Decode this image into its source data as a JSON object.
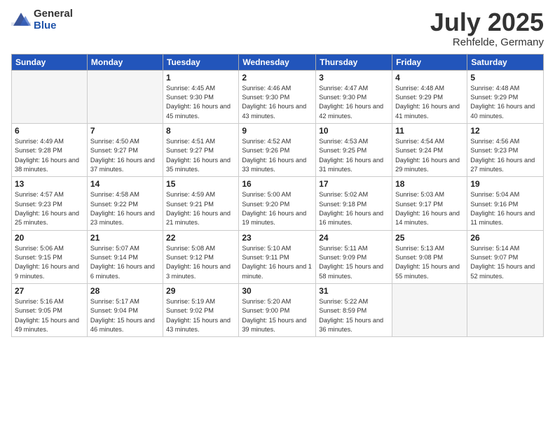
{
  "logo": {
    "general": "General",
    "blue": "Blue"
  },
  "header": {
    "month": "July 2025",
    "location": "Rehfelde, Germany"
  },
  "weekdays": [
    "Sunday",
    "Monday",
    "Tuesday",
    "Wednesday",
    "Thursday",
    "Friday",
    "Saturday"
  ],
  "weeks": [
    [
      {
        "day": "",
        "info": ""
      },
      {
        "day": "",
        "info": ""
      },
      {
        "day": "1",
        "info": "Sunrise: 4:45 AM\nSunset: 9:30 PM\nDaylight: 16 hours\nand 45 minutes."
      },
      {
        "day": "2",
        "info": "Sunrise: 4:46 AM\nSunset: 9:30 PM\nDaylight: 16 hours\nand 43 minutes."
      },
      {
        "day": "3",
        "info": "Sunrise: 4:47 AM\nSunset: 9:30 PM\nDaylight: 16 hours\nand 42 minutes."
      },
      {
        "day": "4",
        "info": "Sunrise: 4:48 AM\nSunset: 9:29 PM\nDaylight: 16 hours\nand 41 minutes."
      },
      {
        "day": "5",
        "info": "Sunrise: 4:48 AM\nSunset: 9:29 PM\nDaylight: 16 hours\nand 40 minutes."
      }
    ],
    [
      {
        "day": "6",
        "info": "Sunrise: 4:49 AM\nSunset: 9:28 PM\nDaylight: 16 hours\nand 38 minutes."
      },
      {
        "day": "7",
        "info": "Sunrise: 4:50 AM\nSunset: 9:27 PM\nDaylight: 16 hours\nand 37 minutes."
      },
      {
        "day": "8",
        "info": "Sunrise: 4:51 AM\nSunset: 9:27 PM\nDaylight: 16 hours\nand 35 minutes."
      },
      {
        "day": "9",
        "info": "Sunrise: 4:52 AM\nSunset: 9:26 PM\nDaylight: 16 hours\nand 33 minutes."
      },
      {
        "day": "10",
        "info": "Sunrise: 4:53 AM\nSunset: 9:25 PM\nDaylight: 16 hours\nand 31 minutes."
      },
      {
        "day": "11",
        "info": "Sunrise: 4:54 AM\nSunset: 9:24 PM\nDaylight: 16 hours\nand 29 minutes."
      },
      {
        "day": "12",
        "info": "Sunrise: 4:56 AM\nSunset: 9:23 PM\nDaylight: 16 hours\nand 27 minutes."
      }
    ],
    [
      {
        "day": "13",
        "info": "Sunrise: 4:57 AM\nSunset: 9:23 PM\nDaylight: 16 hours\nand 25 minutes."
      },
      {
        "day": "14",
        "info": "Sunrise: 4:58 AM\nSunset: 9:22 PM\nDaylight: 16 hours\nand 23 minutes."
      },
      {
        "day": "15",
        "info": "Sunrise: 4:59 AM\nSunset: 9:21 PM\nDaylight: 16 hours\nand 21 minutes."
      },
      {
        "day": "16",
        "info": "Sunrise: 5:00 AM\nSunset: 9:20 PM\nDaylight: 16 hours\nand 19 minutes."
      },
      {
        "day": "17",
        "info": "Sunrise: 5:02 AM\nSunset: 9:18 PM\nDaylight: 16 hours\nand 16 minutes."
      },
      {
        "day": "18",
        "info": "Sunrise: 5:03 AM\nSunset: 9:17 PM\nDaylight: 16 hours\nand 14 minutes."
      },
      {
        "day": "19",
        "info": "Sunrise: 5:04 AM\nSunset: 9:16 PM\nDaylight: 16 hours\nand 11 minutes."
      }
    ],
    [
      {
        "day": "20",
        "info": "Sunrise: 5:06 AM\nSunset: 9:15 PM\nDaylight: 16 hours\nand 9 minutes."
      },
      {
        "day": "21",
        "info": "Sunrise: 5:07 AM\nSunset: 9:14 PM\nDaylight: 16 hours\nand 6 minutes."
      },
      {
        "day": "22",
        "info": "Sunrise: 5:08 AM\nSunset: 9:12 PM\nDaylight: 16 hours\nand 3 minutes."
      },
      {
        "day": "23",
        "info": "Sunrise: 5:10 AM\nSunset: 9:11 PM\nDaylight: 16 hours\nand 1 minute."
      },
      {
        "day": "24",
        "info": "Sunrise: 5:11 AM\nSunset: 9:09 PM\nDaylight: 15 hours\nand 58 minutes."
      },
      {
        "day": "25",
        "info": "Sunrise: 5:13 AM\nSunset: 9:08 PM\nDaylight: 15 hours\nand 55 minutes."
      },
      {
        "day": "26",
        "info": "Sunrise: 5:14 AM\nSunset: 9:07 PM\nDaylight: 15 hours\nand 52 minutes."
      }
    ],
    [
      {
        "day": "27",
        "info": "Sunrise: 5:16 AM\nSunset: 9:05 PM\nDaylight: 15 hours\nand 49 minutes."
      },
      {
        "day": "28",
        "info": "Sunrise: 5:17 AM\nSunset: 9:04 PM\nDaylight: 15 hours\nand 46 minutes."
      },
      {
        "day": "29",
        "info": "Sunrise: 5:19 AM\nSunset: 9:02 PM\nDaylight: 15 hours\nand 43 minutes."
      },
      {
        "day": "30",
        "info": "Sunrise: 5:20 AM\nSunset: 9:00 PM\nDaylight: 15 hours\nand 39 minutes."
      },
      {
        "day": "31",
        "info": "Sunrise: 5:22 AM\nSunset: 8:59 PM\nDaylight: 15 hours\nand 36 minutes."
      },
      {
        "day": "",
        "info": ""
      },
      {
        "day": "",
        "info": ""
      }
    ]
  ]
}
